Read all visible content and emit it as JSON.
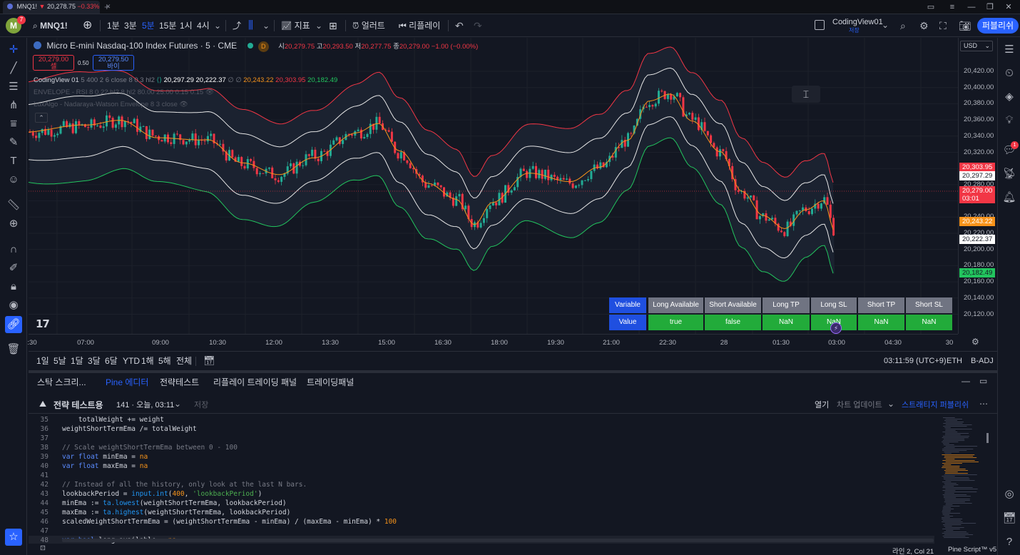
{
  "titlebar": {
    "tab_title": "MNQ1!",
    "tab_price": "20,278.75",
    "tab_change": "−0.33%",
    "new_tab_icon": "plus-icon"
  },
  "toolbar": {
    "avatar_letter": "M",
    "notifications": "7",
    "symbol": "MNQ1!",
    "intervals": [
      "1분",
      "3분",
      "5분",
      "15분",
      "1시",
      "4시"
    ],
    "active_interval": "5분",
    "indicators_label": "지표",
    "alerts_label": "얼러트",
    "replay_label": "리플레이",
    "layout_name": "CodingView01",
    "layout_sub": "저장",
    "publish_label": "퍼블리쉬"
  },
  "legend": {
    "title": "Micro E-mini Nasdaq-100 Index Futures · 5 · CME",
    "badge": "D",
    "o_label": "시",
    "o": "20,279.75",
    "h_label": "고",
    "h": "20,293.50",
    "l_label": "저",
    "l": "20,277.75",
    "c_label": "종",
    "c": "20,279.00",
    "change": "−1.00 (−0.00%)",
    "bid": "20,279.00",
    "bid_label": "셀",
    "spread": "0.50",
    "ask": "20,279.50",
    "ask_label": "바이",
    "ind1_name": "CodingView 01",
    "ind1_params": "5 400 2 6 close 8 0.3 hl2",
    "ind1_v1": "20,297.29",
    "ind1_v2": "20,222.37",
    "ind1_v3": "∅ ∅",
    "ind1_v4": "20,243.22",
    "ind1_v5": "20,303.95",
    "ind1_v6": "20,182.49",
    "ind2": "ENVELOPE - RSI 8 0.22 hl2 8 hl2 80.00 25.00 0.15 0.15",
    "ind3": "LuxAlgo - Nadaraya-Watson Envelope 8 3 close"
  },
  "price_axis": {
    "currency": "USD",
    "ticks": [
      "20,420.00",
      "20,400.00",
      "20,380.00",
      "20,360.00",
      "20,340.00",
      "20,320.00",
      "20,300.00",
      "20,280.00",
      "20,260.00",
      "20,240.00",
      "20,220.00",
      "20,200.00",
      "20,180.00",
      "20,160.00",
      "20,140.00",
      "20,120.00"
    ],
    "label_upper_red": "20,303.95",
    "label_upper_white": "20,297.29",
    "label_last": "20,279.00",
    "label_countdown": "03:01",
    "label_orange": "20,243.22",
    "label_lower_white": "20,222.37",
    "label_green": "20,182.49"
  },
  "time_axis": {
    "ticks": [
      ":30",
      "07:00",
      "09:00",
      "10:30",
      "12:00",
      "13:30",
      "15:00",
      "16:30",
      "18:00",
      "19:30",
      "21:00",
      "22:30",
      "28",
      "01:30",
      "03:00",
      "04:30",
      "30"
    ]
  },
  "strategy_table": {
    "headers": [
      "Variable",
      "Long Available",
      "Short Available",
      "Long TP",
      "Long SL",
      "Short TP",
      "Short SL"
    ],
    "values": [
      "Value",
      "true",
      "false",
      "NaN",
      "NaN",
      "NaN",
      "NaN"
    ]
  },
  "range_bar": {
    "ranges": [
      "1일",
      "5날",
      "1달",
      "3달",
      "6달",
      "YTD",
      "1해",
      "5해",
      "전체"
    ],
    "clock": "03:11:59 (UTC+9)",
    "session": "ETH",
    "adj": "B-ADJ"
  },
  "editor": {
    "tabs": [
      "스탁 스크리...",
      "Pine 에디터",
      "전략테스트",
      "리플레이 트레이딩 패널",
      "트레이딩패널"
    ],
    "active_tab": "Pine 에디터",
    "script_name": "전략 테스트용",
    "version": "141 · 오늘, 03:11",
    "save_label": "저장",
    "open_label": "열기",
    "update_label": "차트 업데이트",
    "publish_label": "스트래티지 퍼블리쉬",
    "code": [
      {
        "n": "35",
        "t": "    totalWeight += weight"
      },
      {
        "n": "36",
        "t": "weightShortTermEma /= totalWeight"
      },
      {
        "n": "37",
        "t": ""
      },
      {
        "n": "38",
        "t": "// Scale weightShortTermEma between 0 - 100"
      },
      {
        "n": "39",
        "t": "var float minEma = na"
      },
      {
        "n": "40",
        "t": "var float maxEma = na"
      },
      {
        "n": "41",
        "t": ""
      },
      {
        "n": "42",
        "t": "// Instead of all the history, only look at the last N bars."
      },
      {
        "n": "43",
        "t": "lookbackPeriod = input.int(400, 'lookbackPeriod')"
      },
      {
        "n": "44",
        "t": "minEma := ta.lowest(weightShortTermEma, lookbackPeriod)"
      },
      {
        "n": "45",
        "t": "maxEma := ta.highest(weightShortTermEma, lookbackPeriod)"
      },
      {
        "n": "46",
        "t": "scaledWeightShortTermEma = (weightShortTermEma - minEma) / (maxEma - minEma) * 100"
      },
      {
        "n": "47",
        "t": ""
      },
      {
        "n": "48",
        "t": "var bool long_available = na"
      }
    ],
    "cursor": "라인 2, Col 21",
    "language": "Pine Script™ v5"
  },
  "colors": {
    "bg": "#131722",
    "up": "#22ab94",
    "down": "#f23645",
    "upper_band": "#f23645",
    "lower_band": "#22c55e",
    "mid_line": "#f7931a",
    "accent": "#2962ff"
  }
}
